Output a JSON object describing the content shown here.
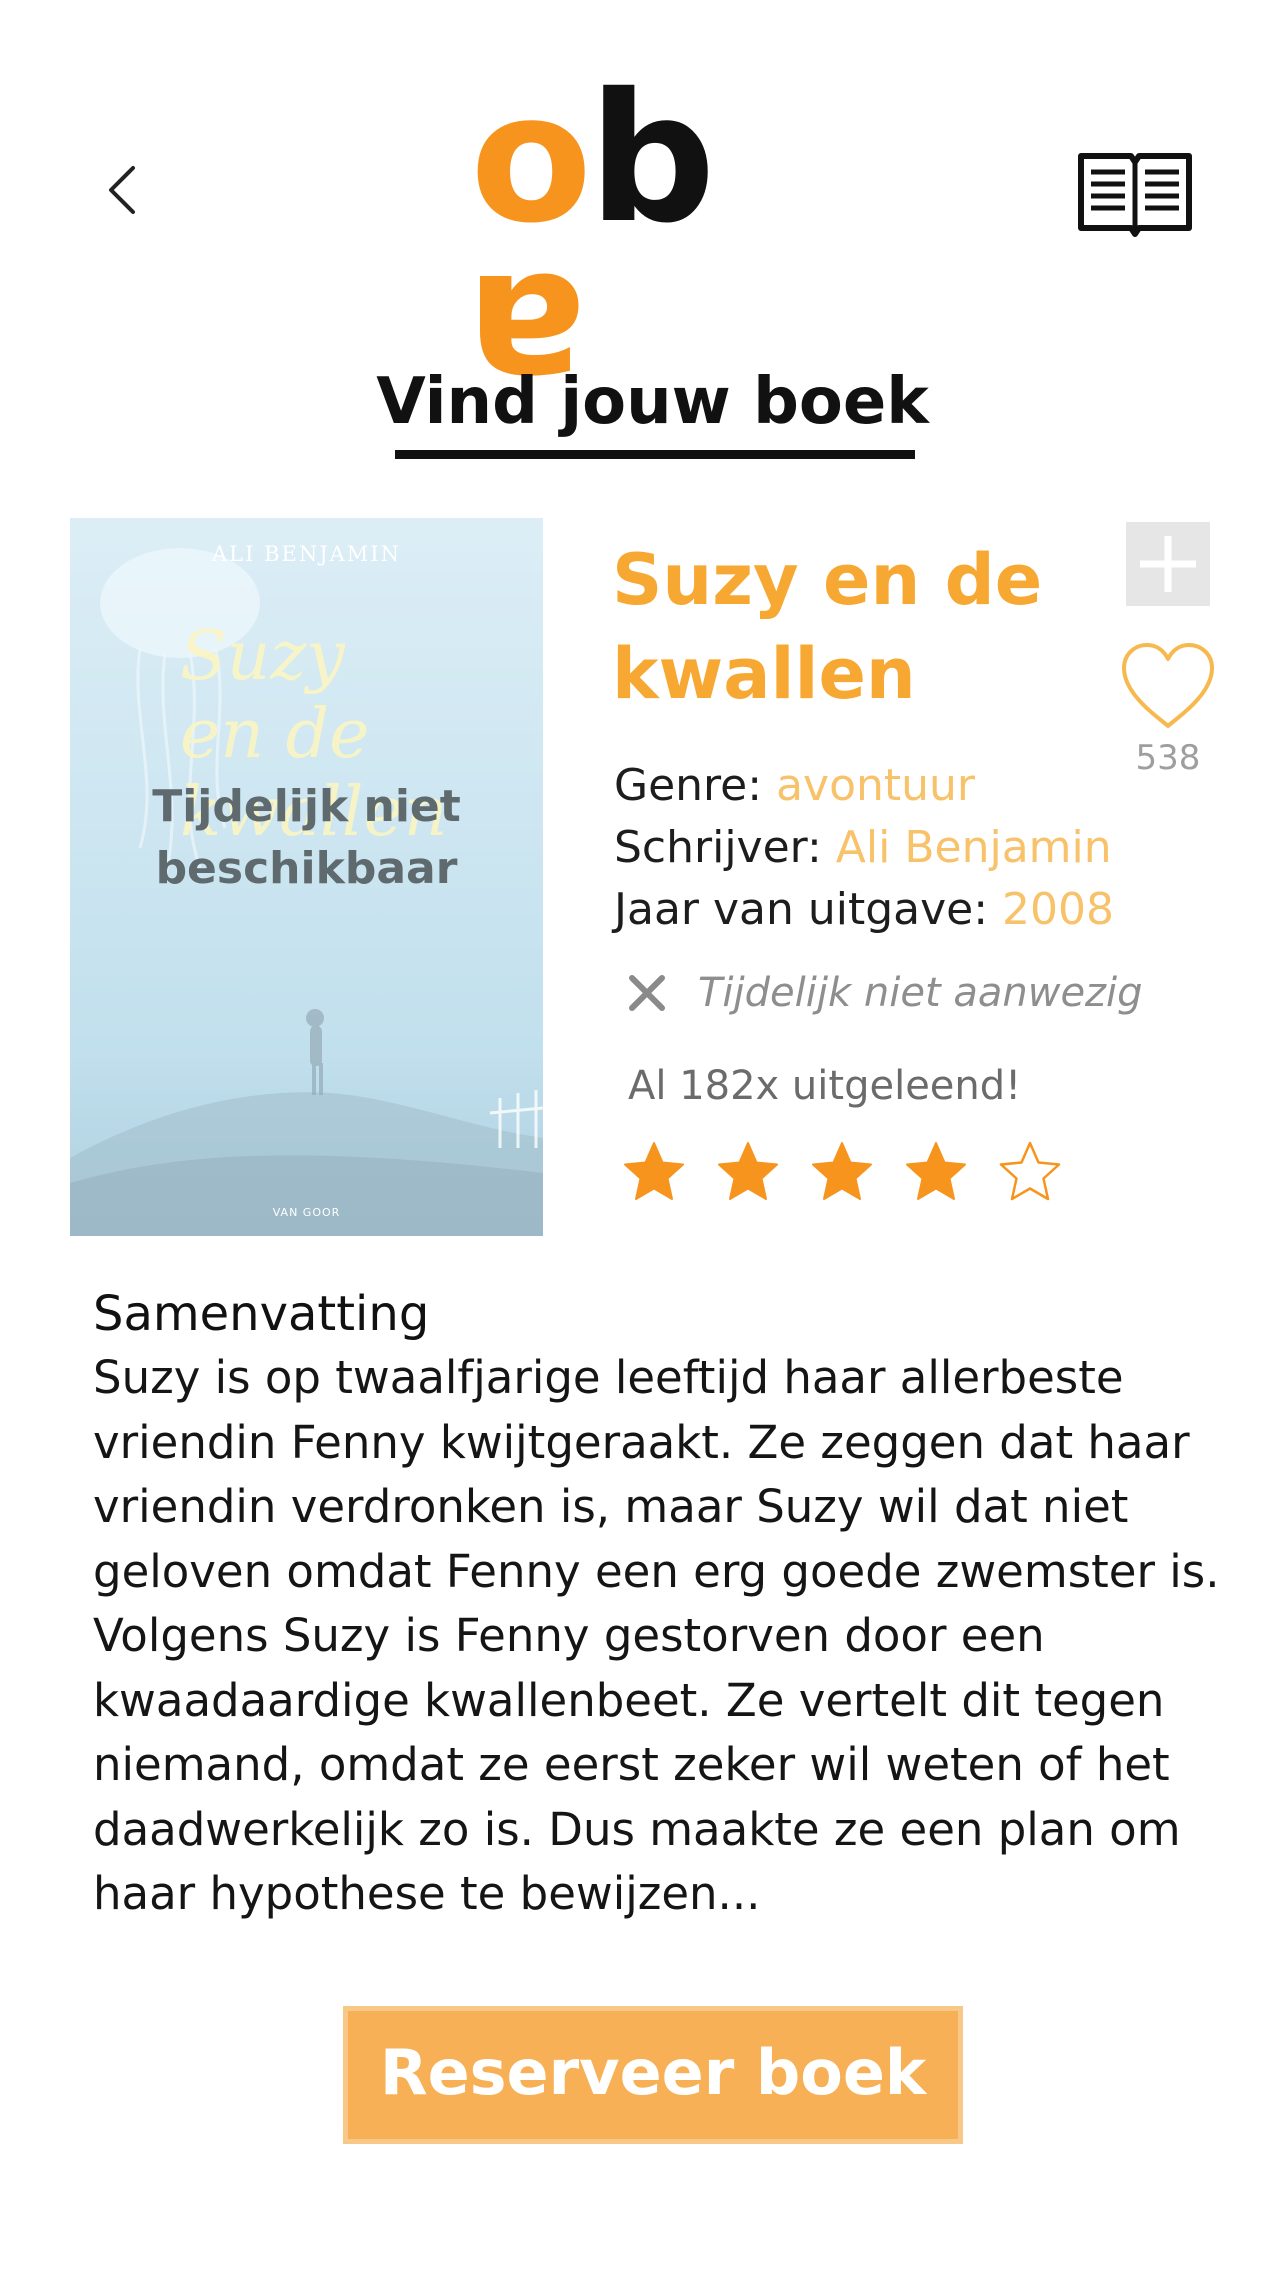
{
  "header": {
    "back_icon": "chevron-left-icon",
    "logo_text": "oba",
    "logo_letters": [
      "o",
      "b",
      "a"
    ],
    "book_icon": "open-book-icon"
  },
  "page": {
    "title": "Vind jouw boek"
  },
  "book": {
    "title": "Suzy en de kwallen",
    "cover": {
      "author": "ALI BENJAMIN",
      "title": "Suzy\nen de\nkwallen",
      "publisher": "VAN GOOR",
      "status_overlay": "Tijdelijk niet beschikbaar"
    },
    "likes": "538",
    "genre_label": "Genre:",
    "genre": "avontuur",
    "writer_label": "Schrijver:",
    "writer": "Ali Benjamin",
    "year_label": "Jaar van uitgave:",
    "year": "2008",
    "availability": "Tijdelijk niet aanwezig",
    "loans": "Al 182x uitgeleend!",
    "rating": 4,
    "rating_max": 5
  },
  "summary": {
    "heading": "Samenvatting",
    "text": "Suzy is op twaalfjarige leeftijd haar allerbeste vriendin Fenny kwijtgeraakt. Ze zeggen dat haar vriendin verdronken is, maar Suzy wil dat niet geloven omdat Fenny een erg goede zwemster is. Volgens Suzy is Fenny gestorven door een kwaadaardige kwallenbeet. Ze vertelt dit tegen niemand, omdat ze eerst zeker wil weten of het daadwerkelijk zo is. Dus maakte ze een plan om haar hypothese te bewijzen..."
  },
  "actions": {
    "reserve_label": "Reserveer boek"
  },
  "colors": {
    "accent": "#f7941d",
    "title": "#f7a832",
    "meta_value": "#f8c26a",
    "button": "#f7b055"
  }
}
